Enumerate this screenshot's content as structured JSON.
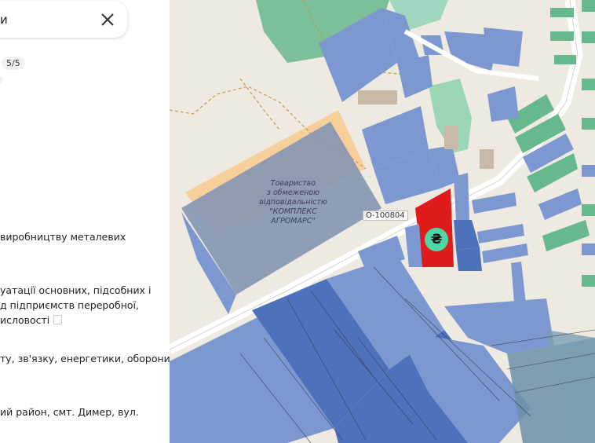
{
  "search": {
    "text": "и"
  },
  "result": {
    "counter": "5/5"
  },
  "details": {
    "line1": "виробництву металевих",
    "line2": "уатації основних, підсобних і",
    "line3": "д підприємств переробної,",
    "line4": "исловості",
    "line5": "ту, зв'язку, енергетики, оборони",
    "line6": "ий район, смт. Димер, вул."
  },
  "map": {
    "company_label": [
      "Товариство",
      "з обмеженою",
      "відповідальністю",
      "\"КОМПЛЕКС",
      "АГРОМАРС\""
    ],
    "parcel_id": "О-100804",
    "currency_symbol": "₴",
    "colors": {
      "background": "#eeeae2",
      "parcel": "#7d98d0",
      "parcel_dark": "#4d72bb",
      "forest": "#66b98c",
      "selected": "#df1b1b",
      "marker": "#4fd6a6",
      "orange_zone": "#f6cf9b",
      "boundary": "#c49a4b"
    }
  }
}
